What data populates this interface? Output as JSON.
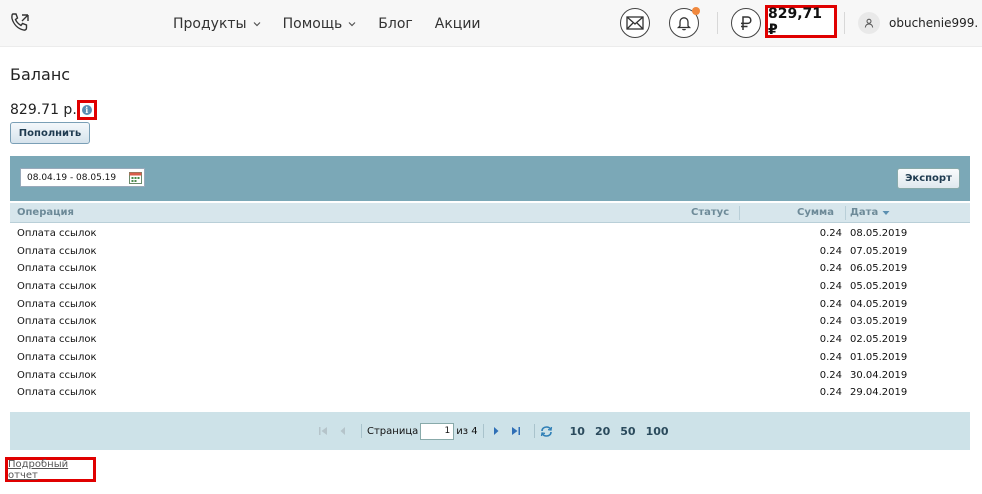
{
  "header": {
    "nav": [
      {
        "label": "Продукты",
        "dropdown": true
      },
      {
        "label": "Помощь",
        "dropdown": true
      },
      {
        "label": "Блог",
        "dropdown": false
      },
      {
        "label": "Акции",
        "dropdown": false
      }
    ],
    "balance": "829,71 ₽",
    "username": "obuchenie999...",
    "notification_dot_color": "#f0883e"
  },
  "page": {
    "title": "Баланс",
    "balance_text": "829.71 р.",
    "info_icon": "i",
    "topup_label": "Пополнить",
    "report_link": "Подробный отчет"
  },
  "grid": {
    "date_range": "08.04.19 - 08.05.19",
    "export_label": "Экспорт",
    "columns": {
      "operation": "Операция",
      "status": "Статус",
      "sum": "Сумма",
      "date": "Дата"
    },
    "rows": [
      {
        "operation": "Оплата ссылок",
        "status": "",
        "sum": "0.24",
        "date": "08.05.2019"
      },
      {
        "operation": "Оплата ссылок",
        "status": "",
        "sum": "0.24",
        "date": "07.05.2019"
      },
      {
        "operation": "Оплата ссылок",
        "status": "",
        "sum": "0.24",
        "date": "06.05.2019"
      },
      {
        "operation": "Оплата ссылок",
        "status": "",
        "sum": "0.24",
        "date": "05.05.2019"
      },
      {
        "operation": "Оплата ссылок",
        "status": "",
        "sum": "0.24",
        "date": "04.05.2019"
      },
      {
        "operation": "Оплата ссылок",
        "status": "",
        "sum": "0.24",
        "date": "03.05.2019"
      },
      {
        "operation": "Оплата ссылок",
        "status": "",
        "sum": "0.24",
        "date": "02.05.2019"
      },
      {
        "operation": "Оплата ссылок",
        "status": "",
        "sum": "0.24",
        "date": "01.05.2019"
      },
      {
        "operation": "Оплата ссылок",
        "status": "",
        "sum": "0.24",
        "date": "30.04.2019"
      },
      {
        "operation": "Оплата ссылок",
        "status": "",
        "sum": "0.24",
        "date": "29.04.2019"
      }
    ],
    "pager": {
      "page_label": "Страница",
      "page_value": "1",
      "of_label": "из 4",
      "sizes": [
        "10",
        "20",
        "50",
        "100"
      ]
    }
  }
}
